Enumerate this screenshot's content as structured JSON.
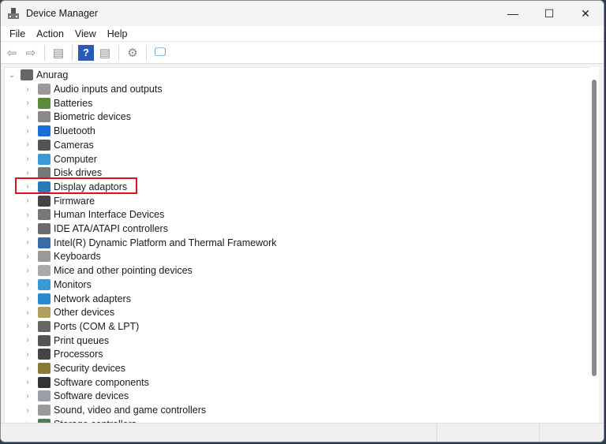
{
  "window": {
    "title": "Device Manager",
    "minimize": "—",
    "maximize": "☐",
    "close": "✕"
  },
  "menu": [
    "File",
    "Action",
    "View",
    "Help"
  ],
  "toolbar": [
    {
      "icon": "back-arrow-icon",
      "glyph": "⇦"
    },
    {
      "icon": "forward-arrow-icon",
      "glyph": "⇨"
    },
    {
      "icon": "show-hide-console-tree-icon",
      "glyph": "▤"
    },
    {
      "icon": "help-icon",
      "glyph": "?"
    },
    {
      "icon": "properties-icon",
      "glyph": "▤"
    },
    {
      "icon": "update-driver-icon",
      "glyph": "⚙"
    },
    {
      "icon": "scan-hardware-changes-icon",
      "glyph": "🖵"
    }
  ],
  "tree": {
    "root": "Anurag",
    "items": [
      {
        "label": "Audio inputs and outputs",
        "color": "#9a9a9a"
      },
      {
        "label": "Batteries",
        "color": "#5a8a3a"
      },
      {
        "label": "Biometric devices",
        "color": "#8a8a8a"
      },
      {
        "label": "Bluetooth",
        "color": "#1a6fd6"
      },
      {
        "label": "Cameras",
        "color": "#555555"
      },
      {
        "label": "Computer",
        "color": "#3a9ad6"
      },
      {
        "label": "Disk drives",
        "color": "#777777"
      },
      {
        "label": "Display adaptors",
        "color": "#2a7ab8"
      },
      {
        "label": "Firmware",
        "color": "#444444"
      },
      {
        "label": "Human Interface Devices",
        "color": "#777777"
      },
      {
        "label": "IDE ATA/ATAPI controllers",
        "color": "#6a6a6a"
      },
      {
        "label": "Intel(R) Dynamic Platform and Thermal Framework",
        "color": "#3a6aa8"
      },
      {
        "label": "Keyboards",
        "color": "#999999"
      },
      {
        "label": "Mice and other pointing devices",
        "color": "#aaaaaa"
      },
      {
        "label": "Monitors",
        "color": "#3a9ad6"
      },
      {
        "label": "Network adapters",
        "color": "#2a8ad0"
      },
      {
        "label": "Other devices",
        "color": "#b0a060"
      },
      {
        "label": "Ports (COM & LPT)",
        "color": "#666666"
      },
      {
        "label": "Print queues",
        "color": "#555555"
      },
      {
        "label": "Processors",
        "color": "#444444"
      },
      {
        "label": "Security devices",
        "color": "#8a7a3a"
      },
      {
        "label": "Software components",
        "color": "#333333"
      },
      {
        "label": "Software devices",
        "color": "#9aa0a8"
      },
      {
        "label": "Sound, video and game controllers",
        "color": "#9a9a9a"
      },
      {
        "label": "Storage controllers",
        "color": "#5a7a5a"
      }
    ],
    "highlighted": "Display adaptors",
    "highlight_color": "#e0101a"
  }
}
